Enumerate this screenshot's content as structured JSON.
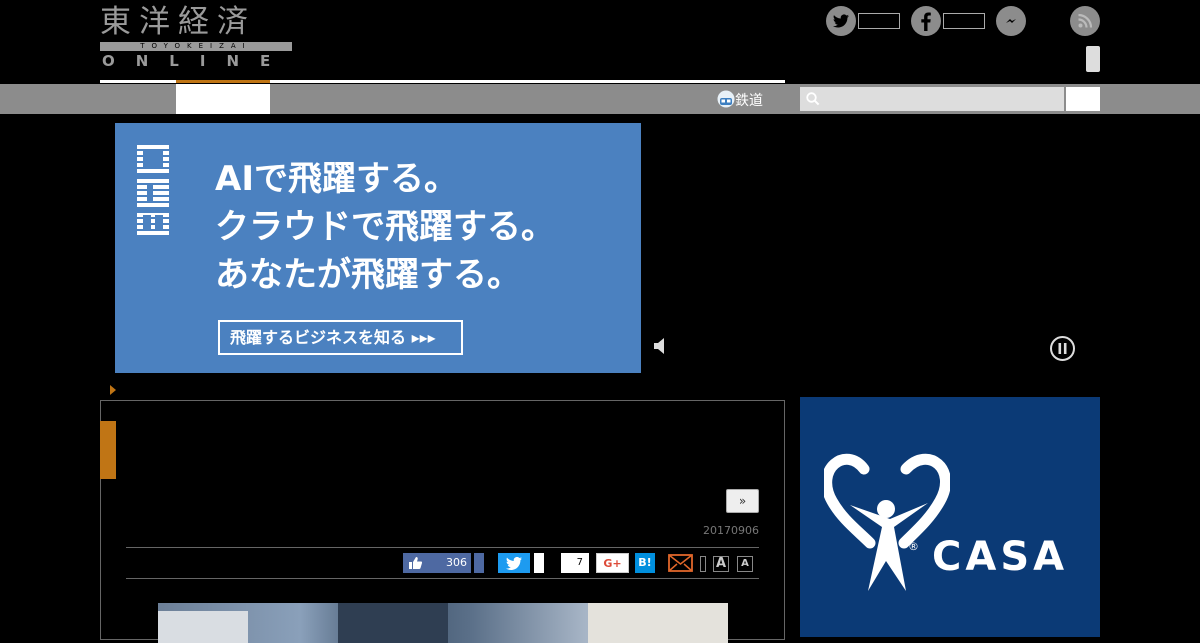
{
  "header": {
    "logo_jp": "東洋経済",
    "logo_romaji": "TOYOKEIZAI",
    "logo_online": "ONLINE"
  },
  "social": {
    "icons": [
      "twitter-icon",
      "facebook-icon",
      "messenger-icon",
      "rss-icon"
    ]
  },
  "nav": {
    "rail_label": "鉄道",
    "search_placeholder": ""
  },
  "ad_banner": {
    "brand": "IBM",
    "line1": "AIで飛躍する。",
    "line2": "クラウドで飛躍する。",
    "line3": "あなたが飛躍する。",
    "cta": "飛躍するビジネスを知る ▸▸▸"
  },
  "article": {
    "next_label": "»",
    "date": "20170906",
    "like_count": "306",
    "pocket_count": "7",
    "gplus_label": "G+",
    "hatena_label": "B!",
    "font_large": "A",
    "font_small": "A"
  },
  "sidebar_ad": {
    "brand": "CASA",
    "mark": "®"
  },
  "colors": {
    "accent": "#c07515",
    "nav_gray": "#8c8c8c",
    "ibm_blue": "#4b81c0",
    "casa_navy": "#0b3a76"
  }
}
